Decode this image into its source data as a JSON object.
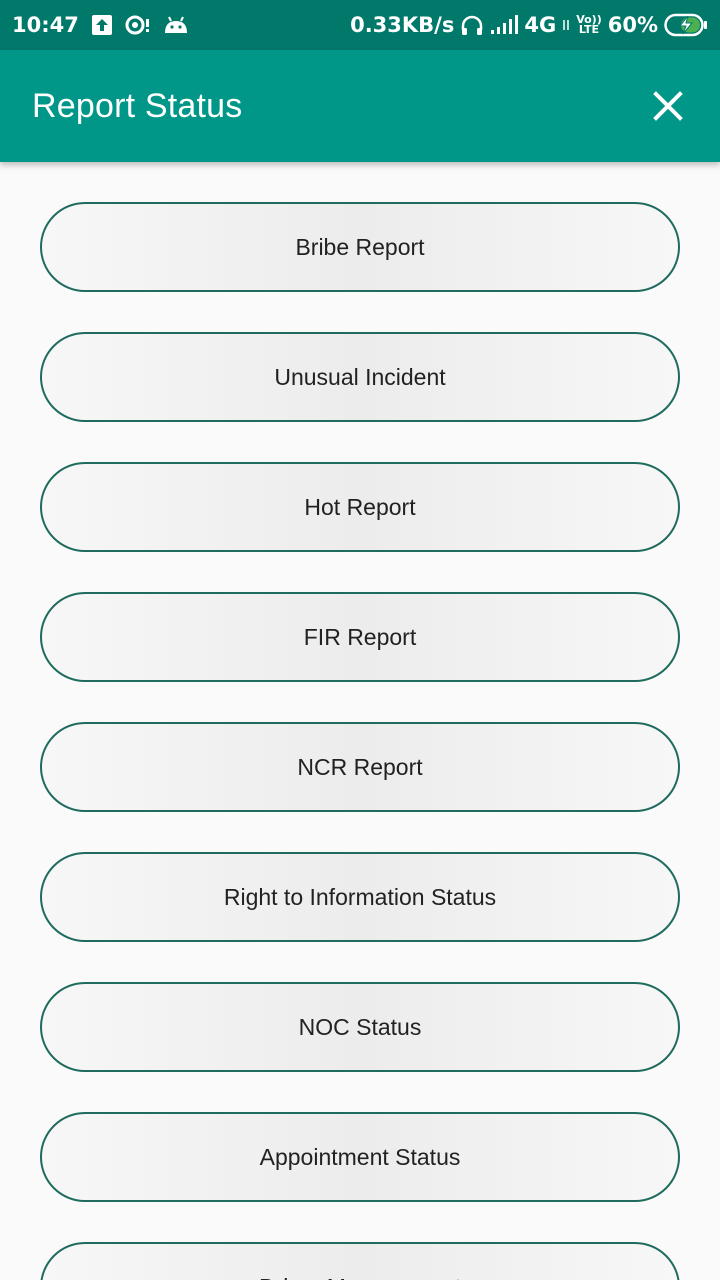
{
  "status_bar": {
    "time": "10:47",
    "net_speed": "0.33KB/s",
    "network": "4G",
    "volte_top": "Vo))",
    "volte_bottom": "LTE",
    "battery": "60%"
  },
  "app_bar": {
    "title": "Report Status"
  },
  "menu": {
    "items": [
      {
        "label": "Bribe Report"
      },
      {
        "label": "Unusual Incident"
      },
      {
        "label": "Hot Report"
      },
      {
        "label": "FIR Report"
      },
      {
        "label": "NCR Report"
      },
      {
        "label": "Right to Information Status"
      },
      {
        "label": "NOC Status"
      },
      {
        "label": "Appointment Status"
      },
      {
        "label": "Driver Management"
      }
    ]
  },
  "colors": {
    "status_bar": "#00796b",
    "app_bar": "#009688",
    "button_border": "#1f6b5e",
    "background": "#fafafa"
  }
}
